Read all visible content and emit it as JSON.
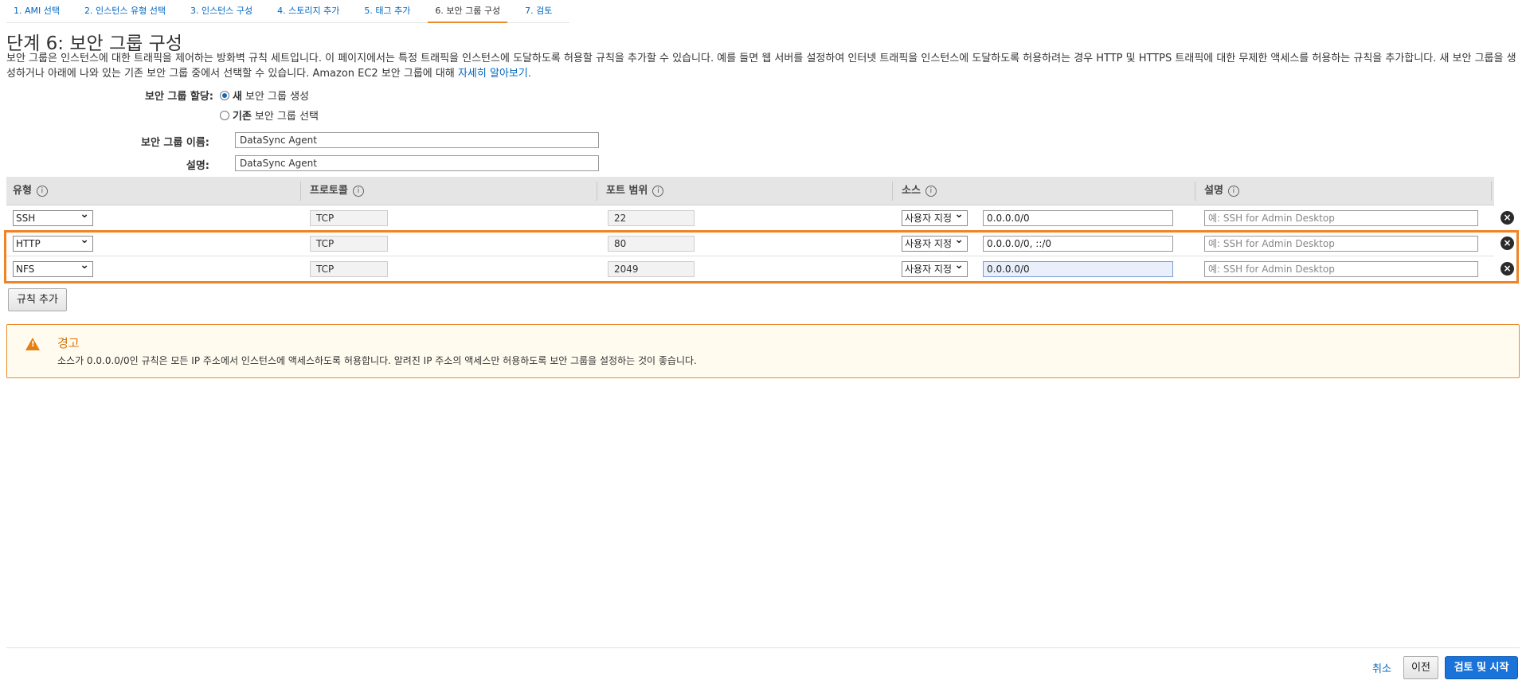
{
  "steps": [
    {
      "label": "1. AMI 선택"
    },
    {
      "label": "2. 인스턴스 유형 선택"
    },
    {
      "label": "3. 인스턴스 구성"
    },
    {
      "label": "4. 스토리지 추가"
    },
    {
      "label": "5. 태그 추가"
    },
    {
      "label": "6. 보안 그룹 구성"
    },
    {
      "label": "7. 검토"
    }
  ],
  "active_step": 6,
  "page_title": "단계 6: 보안 그룹 구성",
  "intro": {
    "text": "보안 그룹은 인스턴스에 대한 트래픽을 제어하는 방화벽 규칙 세트입니다. 이 페이지에서는 특정 트래픽을 인스턴스에 도달하도록 허용할 규칙을 추가할 수 있습니다. 예를 들면 웹 서버를 설정하여 인터넷 트래픽을 인스턴스에 도달하도록 허용하려는 경우 HTTP 및 HTTPS 트래픽에 대한 무제한 액세스를 허용하는 규칙을 추가합니다. 새 보안 그룹을 생성하거나 아래에 나와 있는 기존 보안 그룹 중에서 선택할 수 있습니다. Amazon EC2 보안 그룹에 대해",
    "link": "자세히 알아보기."
  },
  "assignment": {
    "label": "보안 그룹 할당:",
    "options": [
      {
        "bold": "새",
        "rest": "보안 그룹 생성",
        "selected": true
      },
      {
        "bold": "기존",
        "rest": "보안 그룹 선택",
        "selected": false
      }
    ]
  },
  "group_name": {
    "label": "보안 그룹 이름:",
    "value": "DataSync Agent"
  },
  "group_desc": {
    "label": "설명:",
    "value": "DataSync Agent"
  },
  "table": {
    "headers": {
      "type": "유형",
      "protocol": "프로토콜",
      "port": "포트 범위",
      "source": "소스",
      "description": "설명"
    },
    "info_icon": "i",
    "rows": [
      {
        "type": "SSH",
        "protocol": "TCP",
        "port": "22",
        "source_mode": "사용자 지정",
        "source": "0.0.0.0/0",
        "desc_placeholder": "예: SSH for Admin Desktop"
      },
      {
        "type": "HTTP",
        "protocol": "TCP",
        "port": "80",
        "source_mode": "사용자 지정",
        "source": "0.0.0.0/0, ::/0",
        "desc_placeholder": "예: SSH for Admin Desktop"
      },
      {
        "type": "NFS",
        "protocol": "TCP",
        "port": "2049",
        "source_mode": "사용자 지정",
        "source": "0.0.0.0/0",
        "desc_placeholder": "예: SSH for Admin Desktop"
      }
    ],
    "delete_icon": "×"
  },
  "add_rule_label": "규칙 추가",
  "warning": {
    "icon": "!",
    "title": "경고",
    "text": "소스가 0.0.0.0/0인 규칙은 모든 IP 주소에서 인스턴스에 액세스하도록 허용합니다. 알려진 IP 주소의 액세스만 허용하도록 보안 그룹을 설정하는 것이 좋습니다."
  },
  "footer": {
    "cancel": "취소",
    "previous": "이전",
    "review_launch": "검토 및 시작"
  },
  "colors": {
    "accent": "#eb8d2f",
    "link": "#0066c0",
    "primary": "#1a73d9",
    "highlight": "#f08326"
  }
}
